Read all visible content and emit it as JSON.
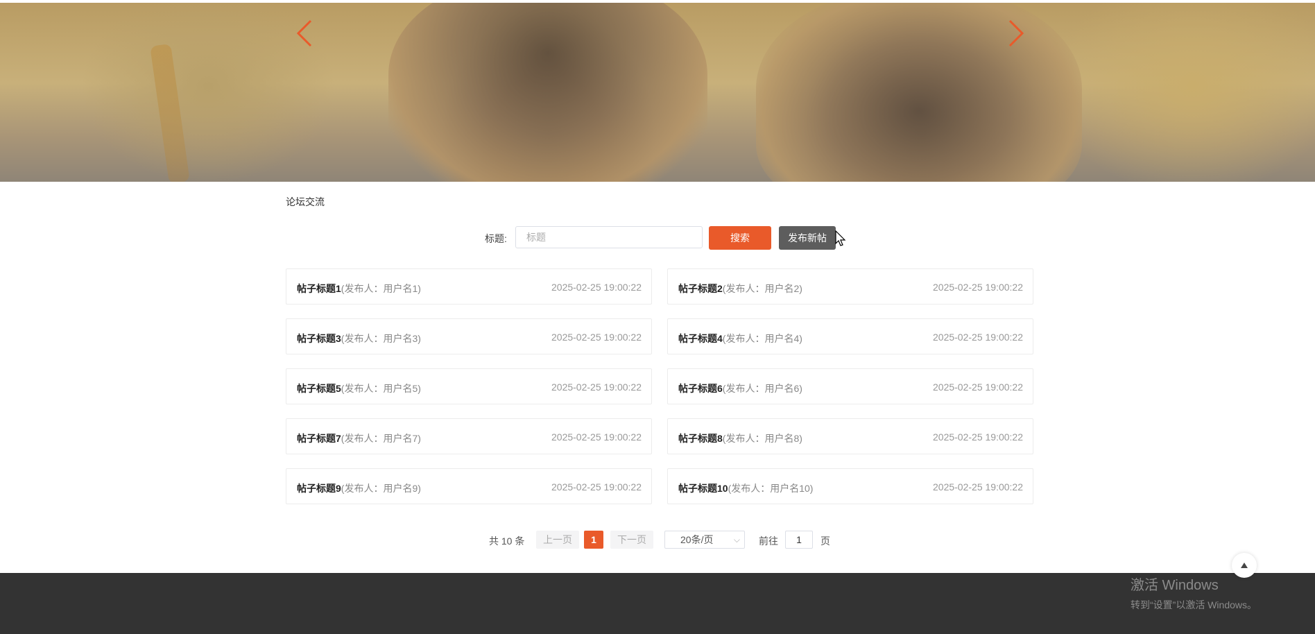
{
  "banner": {
    "prev_icon": "chevron-left-icon",
    "next_icon": "chevron-right-icon",
    "accent": "#e95a2a"
  },
  "breadcrumb": "论坛交流",
  "search": {
    "label": "标题:",
    "placeholder": "标题",
    "value": "",
    "search_button": "搜索",
    "new_post_button": "发布新帖"
  },
  "posts": [
    {
      "title": "帖子标题1",
      "author": "(发布人：用户名1)",
      "date": "2025-02-25 19:00:22"
    },
    {
      "title": "帖子标题2",
      "author": "(发布人：用户名2)",
      "date": "2025-02-25 19:00:22"
    },
    {
      "title": "帖子标题3",
      "author": "(发布人：用户名3)",
      "date": "2025-02-25 19:00:22"
    },
    {
      "title": "帖子标题4",
      "author": "(发布人：用户名4)",
      "date": "2025-02-25 19:00:22"
    },
    {
      "title": "帖子标题5",
      "author": "(发布人：用户名5)",
      "date": "2025-02-25 19:00:22"
    },
    {
      "title": "帖子标题6",
      "author": "(发布人：用户名6)",
      "date": "2025-02-25 19:00:22"
    },
    {
      "title": "帖子标题7",
      "author": "(发布人：用户名7)",
      "date": "2025-02-25 19:00:22"
    },
    {
      "title": "帖子标题8",
      "author": "(发布人：用户名8)",
      "date": "2025-02-25 19:00:22"
    },
    {
      "title": "帖子标题9",
      "author": "(发布人：用户名9)",
      "date": "2025-02-25 19:00:22"
    },
    {
      "title": "帖子标题10",
      "author": "(发布人：用户名10)",
      "date": "2025-02-25 19:00:22"
    }
  ],
  "pagination": {
    "total": "共 10 条",
    "prev": "上一页",
    "current": "1",
    "next": "下一页",
    "page_size": "20条/页",
    "goto_label": "前往",
    "goto_value": "1",
    "page_unit": "页"
  },
  "back_to_top": {
    "icon": "caret-up-icon"
  },
  "watermark": {
    "line1": "激活 Windows",
    "line2": "转到“设置”以激活 Windows。"
  },
  "colors": {
    "primary": "#e95a2a",
    "secondary_button": "#5d5d5d",
    "footer": "#333333"
  }
}
